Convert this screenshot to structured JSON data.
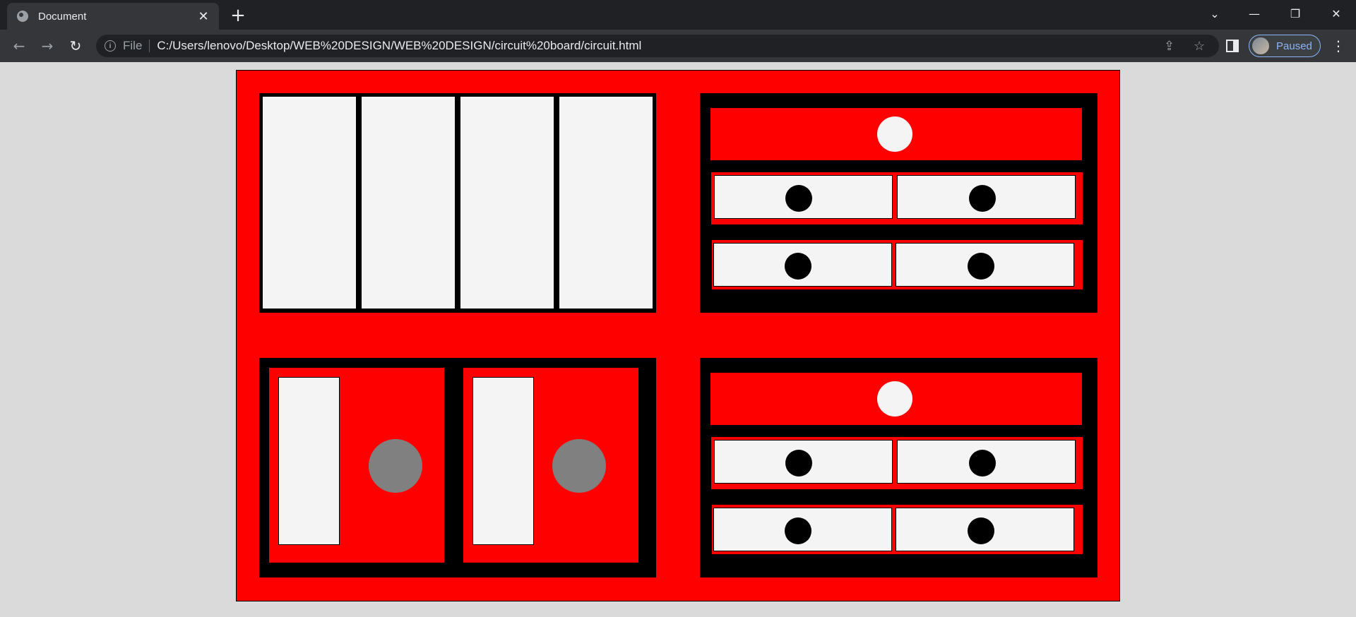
{
  "browser": {
    "tab_title": "Document",
    "tab_close": "✕",
    "new_tab": "+",
    "scheme": "File",
    "url": "C:/Users/lenovo/Desktop/WEB%20DESIGN/WEB%20DESIGN/circuit%20board/circuit.html",
    "profile_label": "Paused",
    "icons": {
      "back": "←",
      "forward": "→",
      "reload": "↻",
      "info": "i",
      "share": "⇪",
      "star": "☆",
      "menu": "⋮",
      "tab_search": "⌄",
      "minimize": "—",
      "restore": "❐",
      "close": "✕"
    }
  },
  "colors": {
    "board": "#ff0000",
    "frame": "#000000",
    "panel": "#f4f4f4",
    "knob": "#808080",
    "chrome_dark": "#202124",
    "chrome_mid": "#35363a"
  }
}
